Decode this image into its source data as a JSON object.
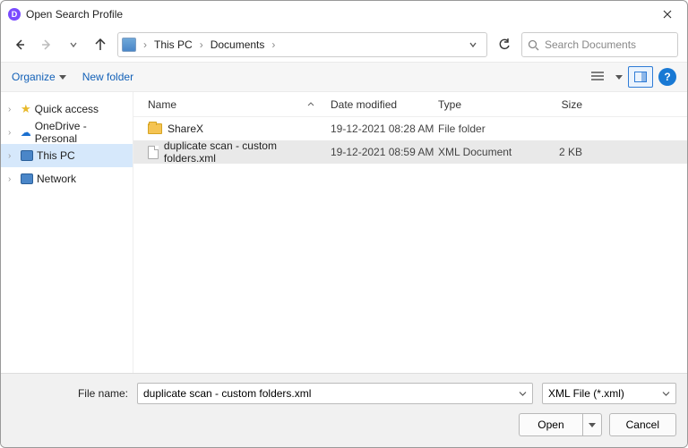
{
  "title": "Open Search Profile",
  "app_icon_letter": "D",
  "breadcrumb": {
    "root": "This PC",
    "folder": "Documents"
  },
  "search": {
    "placeholder": "Search Documents"
  },
  "toolbar": {
    "organize": "Organize",
    "newfolder": "New folder"
  },
  "sidebar": {
    "items": [
      {
        "label": "Quick access"
      },
      {
        "label": "OneDrive - Personal"
      },
      {
        "label": "This PC"
      },
      {
        "label": "Network"
      }
    ]
  },
  "columns": {
    "name": "Name",
    "date": "Date modified",
    "type": "Type",
    "size": "Size"
  },
  "rows": [
    {
      "name": "ShareX",
      "date": "19-12-2021 08:28 AM",
      "type": "File folder",
      "size": ""
    },
    {
      "name": "duplicate scan - custom folders.xml",
      "date": "19-12-2021 08:59 AM",
      "type": "XML Document",
      "size": "2 KB"
    }
  ],
  "footer": {
    "label": "File name:",
    "filename": "duplicate scan - custom folders.xml",
    "filetype": "XML File (*.xml)",
    "open": "Open",
    "cancel": "Cancel"
  }
}
